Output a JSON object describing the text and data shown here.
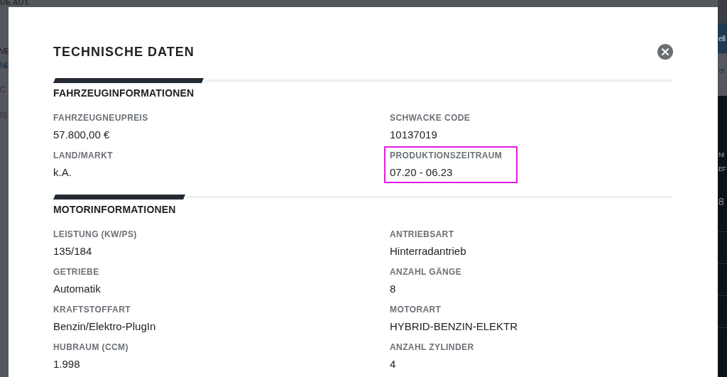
{
  "backdrop": {
    "top_text": "UE AUT.",
    "left_fragments": [
      {
        "text": "VE",
        "kind": "plain"
      },
      {
        "text": "NE",
        "kind": "link"
      },
      {
        "text": "C",
        "kind": "large"
      },
      {
        "text": "01",
        "kind": "large"
      }
    ],
    "right_button": "ell",
    "right_link": "er",
    "right_fragments": [
      {
        "text": "NI",
        "kind": "plain"
      },
      {
        "text": "EF",
        "kind": "plain"
      },
      {
        "text": "8",
        "kind": "large"
      }
    ]
  },
  "dialog": {
    "title": "TECHNISCHE DATEN",
    "sections": [
      {
        "title": "FAHRZEUGINFORMATIONEN",
        "fields": [
          {
            "label": "FAHRZEUGNEUPREIS",
            "value": "57.800,00 €",
            "highlighted": false
          },
          {
            "label": "SCHWACKE CODE",
            "value": "10137019",
            "highlighted": false
          },
          {
            "label": "LAND/MARKT",
            "value": "k.A.",
            "highlighted": false
          },
          {
            "label": "PRODUKTIONSZEITRAUM",
            "value": "07.20 - 06.23",
            "highlighted": true
          }
        ]
      },
      {
        "title": "MOTORINFORMATIONEN",
        "fields": [
          {
            "label": "LEISTUNG (KW/PS)",
            "value": "135/184",
            "highlighted": false
          },
          {
            "label": "ANTRIEBSART",
            "value": "Hinterradantrieb",
            "highlighted": false
          },
          {
            "label": "GETRIEBE",
            "value": "Automatik",
            "highlighted": false
          },
          {
            "label": "ANZAHL GÄNGE",
            "value": "8",
            "highlighted": false
          },
          {
            "label": "KRAFTSTOFFART",
            "value": "Benzin/Elektro-PlugIn",
            "highlighted": false
          },
          {
            "label": "MOTORART",
            "value": "HYBRID-BENZIN-ELEKTR",
            "highlighted": false
          },
          {
            "label": "HUBRAUM (CCM)",
            "value": "1.998",
            "highlighted": false
          },
          {
            "label": "ANZAHL ZYLINDER",
            "value": "4",
            "highlighted": false
          }
        ]
      }
    ]
  }
}
